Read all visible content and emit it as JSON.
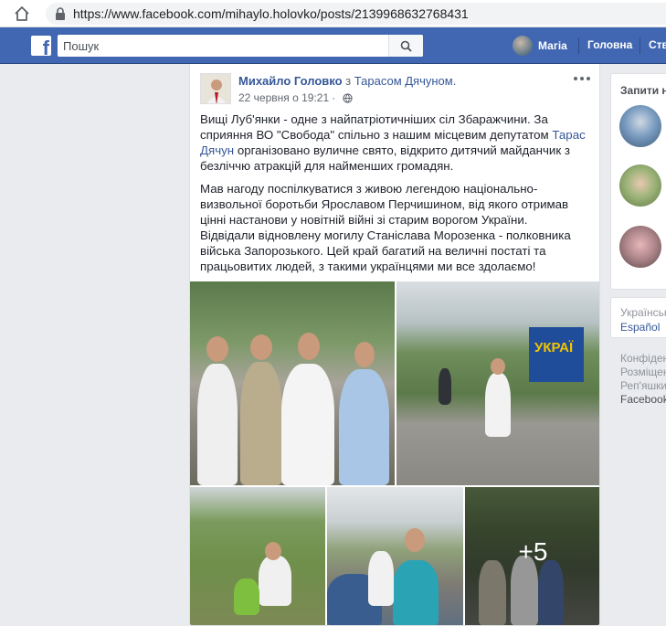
{
  "browser": {
    "url": "https://www.facebook.com/mihaylo.holovko/posts/2139968632768431"
  },
  "header": {
    "logo": "f",
    "search_placeholder": "Пошук",
    "user_name": "Магіа",
    "home_label": "Головна",
    "create_label": "Ств"
  },
  "post": {
    "author": "Михайло Головко",
    "with_text": "з",
    "tagged": "Тарасом Дячуном.",
    "date": "22 червня о 19:21",
    "date_separator": "·",
    "paragraph1_prefix": "Вищі Луб'янки - одне з найпатріотичніших сіл Збаражчини. За сприяння ВО \"Свобода\" спільно з нашим місцевим депутатом ",
    "paragraph1_link": "Тарас Дячун",
    "paragraph1_suffix": " організовано вуличне свято, відкрито дитячий майданчик з безліччю атракцій для найменших громадян.",
    "paragraph2": "Мав нагоду поспілкуватися з живою легендою національно-визвольної боротьби Ярославом Перчишином, від якого отримав цінні настанови у новітній війні зі старим ворогом України.",
    "paragraph3": "Відвідали відновлену могилу Станіслава Морозенка - полковника війська Запорозького. Цей край багатий на величні постаті та працьовитих людей, з такими українцями ми все здолаємо!",
    "more_photos_label": "+5",
    "banner_text": "УКРАЇ"
  },
  "sidebar": {
    "requests_title": "Запити на",
    "lang_current": "Українськ",
    "lang_alt": "Español",
    "footer_links": [
      "Конфіден",
      "Розміщен",
      "Реп'яшки",
      "Facebook"
    ]
  },
  "colors": {
    "brand_blue": "#4267b2",
    "link_blue": "#365899",
    "page_bg": "#e9ebee"
  }
}
